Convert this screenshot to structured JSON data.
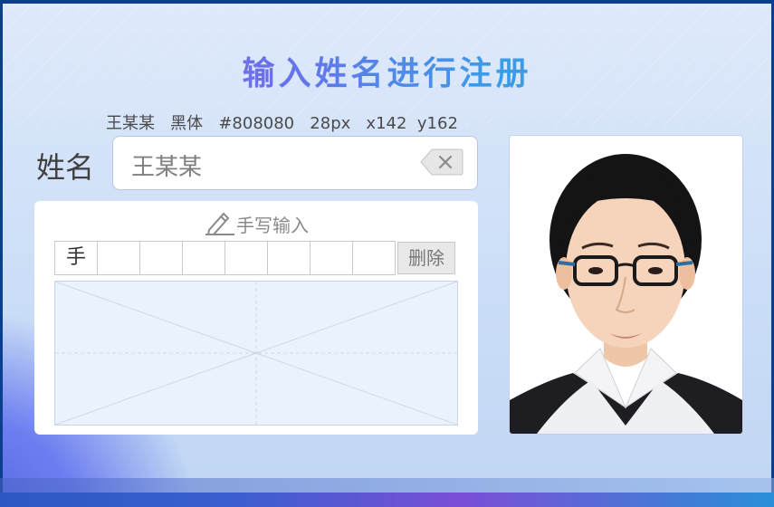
{
  "title": "输入姓名进行注册",
  "hint": "王某某   黑体   #808080   28px   x142  y162",
  "form": {
    "name_label": "姓名",
    "name_value": "王某某"
  },
  "handwriting": {
    "title": "手写输入",
    "candidates": [
      "手",
      "",
      "",
      "",
      "",
      "",
      "",
      ""
    ],
    "delete_label": "删除"
  },
  "icons": {
    "clear": "backspace-clear-icon",
    "pencil": "pencil-icon"
  },
  "colors": {
    "title_gradient": [
      "#b06bef",
      "#6a70ea",
      "#3a9de6"
    ],
    "name_text": "#808080",
    "pad_bg": "#eaf2fd"
  }
}
